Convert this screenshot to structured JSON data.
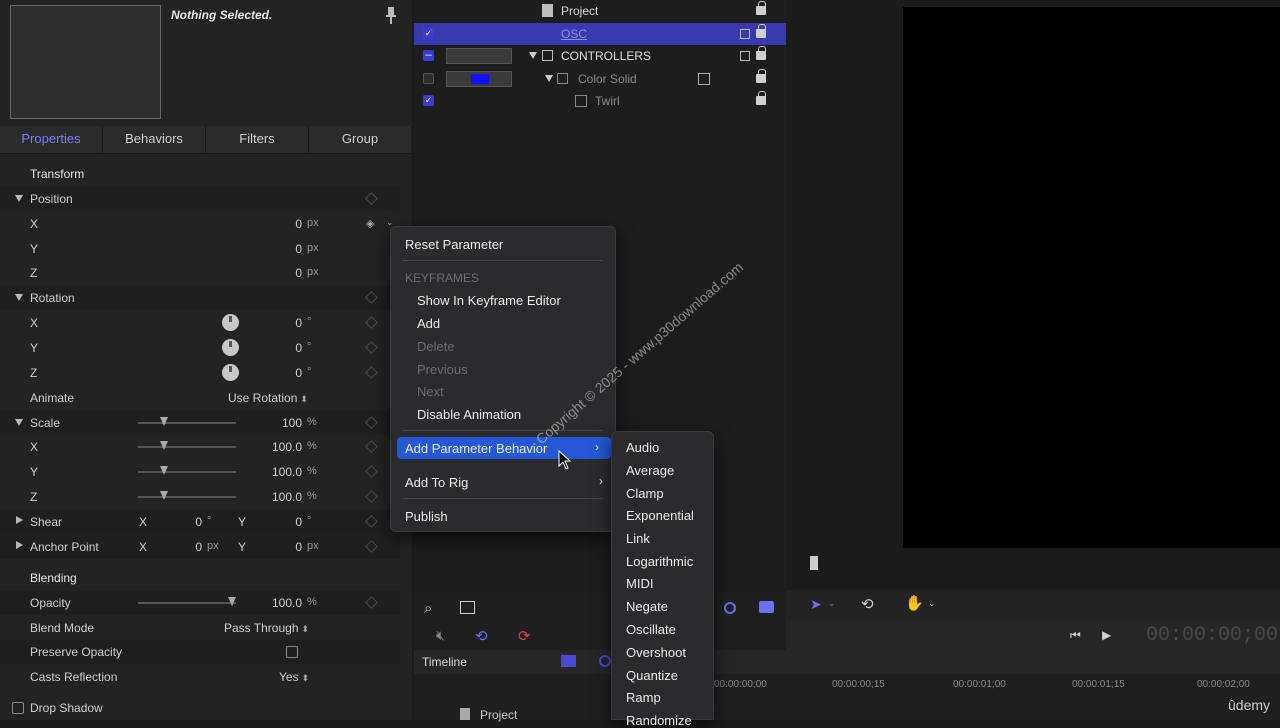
{
  "inspector": {
    "nothing_selected": "Nothing Selected.",
    "tabs": [
      "Properties",
      "Behaviors",
      "Filters",
      "Group"
    ],
    "transform_header": "Transform",
    "position": {
      "label": "Position",
      "x": {
        "label": "X",
        "value": "0",
        "unit": "px"
      },
      "y": {
        "label": "Y",
        "value": "0",
        "unit": "px"
      },
      "z": {
        "label": "Z",
        "value": "0",
        "unit": "px"
      }
    },
    "rotation": {
      "label": "Rotation",
      "x": {
        "label": "X",
        "value": "0",
        "unit": "°"
      },
      "y": {
        "label": "Y",
        "value": "0",
        "unit": "°"
      },
      "z": {
        "label": "Z",
        "value": "0",
        "unit": "°"
      }
    },
    "animate": {
      "label": "Animate",
      "value": "Use Rotation"
    },
    "scale": {
      "label": "Scale",
      "value": "100",
      "unit": "%",
      "x": {
        "label": "X",
        "value": "100.0",
        "unit": "%"
      },
      "y": {
        "label": "Y",
        "value": "100.0",
        "unit": "%"
      },
      "z": {
        "label": "Z",
        "value": "100.0",
        "unit": "%"
      }
    },
    "shear": {
      "label": "Shear",
      "x_label": "X",
      "x_value": "0",
      "x_unit": "°",
      "y_label": "Y",
      "y_value": "0",
      "y_unit": "°"
    },
    "anchor": {
      "label": "Anchor Point",
      "x_label": "X",
      "x_value": "0",
      "x_unit": "px",
      "y_label": "Y",
      "y_value": "0",
      "y_unit": "px"
    },
    "blending_header": "Blending",
    "opacity": {
      "label": "Opacity",
      "value": "100.0",
      "unit": "%"
    },
    "blend_mode": {
      "label": "Blend Mode",
      "value": "Pass Through"
    },
    "preserve_opacity": {
      "label": "Preserve Opacity"
    },
    "casts_reflection": {
      "label": "Casts Reflection",
      "value": "Yes"
    },
    "drop_shadow": {
      "label": "Drop Shadow"
    }
  },
  "layers": {
    "project": "Project",
    "osc": "OSC",
    "controllers": "CONTROLLERS",
    "color_solid": "Color Solid",
    "twirl": "Twirl"
  },
  "context_menu": {
    "reset_parameter": "Reset Parameter",
    "keyframes_header": "KEYFRAMES",
    "show_in_keyframe_editor": "Show In Keyframe Editor",
    "add": "Add",
    "delete": "Delete",
    "previous": "Previous",
    "next": "Next",
    "disable_animation": "Disable Animation",
    "add_parameter_behavior": "Add Parameter Behavior",
    "add_to_rig": "Add To Rig",
    "publish": "Publish"
  },
  "submenu": [
    "Audio",
    "Average",
    "Clamp",
    "Exponential",
    "Link",
    "Logarithmic",
    "MIDI",
    "Negate",
    "Oscillate",
    "Overshoot",
    "Quantize",
    "Ramp",
    "Randomize"
  ],
  "timeline": {
    "label": "Timeline",
    "project": "Project",
    "timecode": "00:00:00;00",
    "ruler": [
      "00:00:00;00",
      "00:00:00;15",
      "00:00:01;00",
      "00:00:01;15",
      "00:00:02;00"
    ]
  },
  "watermark": "Copyright © 2025 - www.p30download.com",
  "udemy": "ûdemy",
  "colors": {
    "accent": "#7d7dff",
    "selection": "#3a3ab0",
    "highlight": "#2458d6",
    "color_solid": "#1010ff"
  }
}
